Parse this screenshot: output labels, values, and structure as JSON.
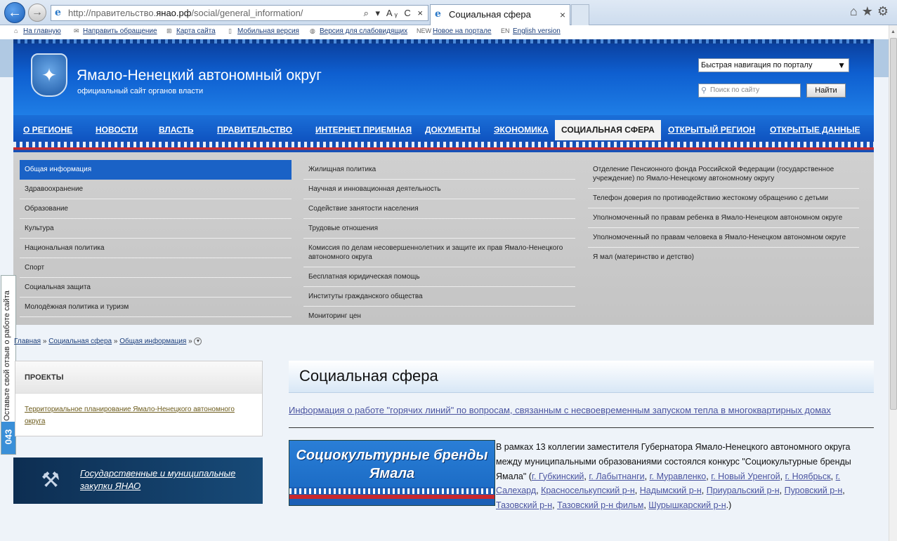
{
  "browser": {
    "address_prefix": "http://правительство.",
    "address_domain": "янао.рф",
    "address_path": "/social/general_information/",
    "tab_title": "Социальная сфера",
    "address_tools": "⌕ ▾ Aᵧ C ×",
    "tab_close": "×",
    "icons": [
      "home-icon",
      "star-icon",
      "gear-icon"
    ]
  },
  "topbar": {
    "links": [
      {
        "icon": "⌂",
        "label": "На главную"
      },
      {
        "icon": "✉",
        "label": "Направить обращение"
      },
      {
        "icon": "⊞",
        "label": "Карта сайта"
      },
      {
        "icon": "▯",
        "label": "Мобильная версия"
      },
      {
        "icon": "◍",
        "label": "Версия для слабовидящих"
      },
      {
        "icon": "NEW",
        "label": "Новое на портале"
      },
      {
        "icon": "EN",
        "label": "English version"
      }
    ]
  },
  "header": {
    "title": "Ямало-Ненецкий автономный округ",
    "subtitle": "официальный сайт органов власти",
    "quicknav": "Быстрая навигация по порталу",
    "search_placeholder": "Поиск по сайту",
    "search_button": "Найти"
  },
  "mainnav": {
    "items": [
      "О РЕГИОНЕ",
      "НОВОСТИ",
      "ВЛАСТЬ",
      "ПРАВИТЕЛЬСТВО",
      "ИНТЕРНЕТ ПРИЕМНАЯ",
      "ДОКУМЕНТЫ",
      "ЭКОНОМИКА",
      "СОЦИАЛЬНАЯ СФЕРА",
      "ОТКРЫТЫЙ РЕГИОН",
      "ОТКРЫТЫЕ ДАННЫЕ"
    ],
    "active": "СОЦИАЛЬНАЯ СФЕРА"
  },
  "submenu": {
    "col1": [
      "Общая информация",
      "Здравоохранение",
      "Образование",
      "Культура",
      "Национальная политика",
      "Спорт",
      "Социальная защита",
      "Молодёжная политика и туризм"
    ],
    "col2": [
      "Жилищная политика",
      "Научная и инновационная деятельность",
      "Содействие занятости населения",
      "Трудовые отношения",
      "Комиссия по делам несовершеннолетних и защите их прав Ямало-Ненецкого автономного округа",
      "Бесплатная юридическая помощь",
      "Институты гражданского общества",
      "Мониторинг цен"
    ],
    "col3": [
      "Отделение Пенсионного фонда Российской Федерации (государственное учреждение) по Ямало-Ненецкому автономному округу",
      "Телефон доверия по противодействию жестокому обращению с детьми",
      "Уполномоченный по правам ребенка в Ямало-Ненецком автономном округе",
      "Уполномоченный по правам человека в Ямало-Ненецком автономном округе",
      "Я мал (материнство и детство)"
    ],
    "active": "Общая информация"
  },
  "feedback": {
    "text": "Оставьте свой отзыв о работе сайта",
    "number": "043"
  },
  "breadcrumb": {
    "items": [
      "Главная",
      "Социальная сфера",
      "Общая информация"
    ],
    "sep": "»"
  },
  "projects": {
    "heading": "ПРОЕКТЫ",
    "link": "Территориальное планирование Ямало-Ненецкого автономного округа"
  },
  "banner": {
    "text": "Государственные и муниципальные закупки ЯНАО"
  },
  "content": {
    "title": "Социальная сфера",
    "hotline": "Информация о работе \"горячих линий\" по вопросам, связанным с несвоевременным запуском тепла в многоквартирных домах",
    "image_line1": "Социокультурные бренды",
    "image_line2": "Ямала",
    "para_intro": "В рамках 13 коллегии заместителя Губернатора Ямало-Ненецкого автономного округа между муниципальными образованиями состоялся конкурс \"Социокультурные бренды Ямала\" (",
    "para_links": [
      "г. Губкинский",
      "г. Лабытнанги",
      "г. Муравленко",
      "г. Новый Уренгой",
      "г. Ноябрьск",
      "г. Салехард",
      "Красноселькупский р-н",
      "Надымский р-н",
      "Приуральский р-н",
      "Пуровский р-н",
      "Тазовский р-н",
      "Тазовский р-н фильм",
      "Шурышкарский р-н"
    ],
    "para_end": ".)"
  }
}
